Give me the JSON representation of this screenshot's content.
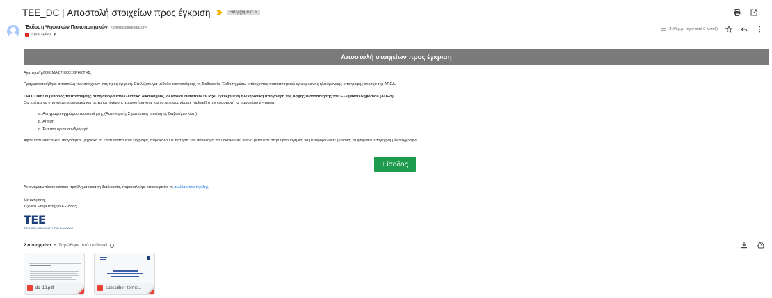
{
  "email": {
    "subject": "TEE_DC | Αποστολή στοιχείων προς έγκριση",
    "label": "Εισερχόμενα",
    "label_close": "×",
    "sender": {
      "name": "Έκδοση Ψηφιακών Πιστοποιητικών",
      "email": "<egenh@indigital.gr>",
      "to": "προς εμένα",
      "time": "8:04 μ.μ. (πριν από 0 λεπτά)"
    }
  },
  "body": {
    "banner": "Αποστολή στοιχείων προς έγκριση",
    "greeting": "Αγαπητέ/ή ΔΟΚΙΜΑΣΤΙΚΟΣ ΧΡΗΣΤΗΣ,",
    "intro": "Πραγματοποιήθηκε αποστολή των στοιχείων σας προς έγκριση. Επιλέξατε για μέθοδο ταυτοποίησης τη διαδικασία: Έκδοση μέσω υπάρχοντος πιστοποιητικού εγκεκριμένης ηλεκτρονικής υπογραφής σε ισχύ της ΑΠΕΔ.",
    "warning": "ΠΡΟΣΟΧΗ! Η μέθοδος ταυτοποίησης αυτή αφορά αποκλειστικά δικαιούχους, οι οποίοι διαθέτουν εν ισχύ εγκεκριμένη ηλεκτρονική υπογραφή της Αρχής Πιστοποίησης του Ελληνικού Δημοσίου (ΑΠΕΔ)",
    "instruction": "Θα πρέπει να υπογράψετε ψηφιακά και με χρήση έγκυρης χρονοσήμανσης και να μεταφορτώσετε (upload) στην εφαρμογή τα παρακάτω έγγραφα:",
    "documents": [
      "a. Αντίγραφο εγγράφου ταυτοποίησης (Αστυνομική, Στρατιωτική ταυτότητα, διαβατήριο κλπ.)",
      "b. Αίτηση",
      "c. Έντυπο όρων συνδρομητή"
    ],
    "followup": "Αφού κατεβάσετε και υπογράψετε ψηφιακά τα επισυναπτόμενα έγγραφα, παρακαλούμε πατήστε τον σύνδεσμο που ακολουθεί, για να μεταβείτε στην εφαρμογή και να μεταφορτώσετε (upload) τα ψηφιακά υπογεγραμμένα έγγραφα.",
    "login_button": "Είσοδος",
    "support_prefix": "Αν αντιμετωπίσετε κάποιο πρόβλημα κατά τη διαδικασία, παρακαλούμε επισκεφτείτε τη ",
    "support_link": "σελίδα υποστήριξης",
    "support_suffix": ".",
    "closing": "Με εκτίμηση,",
    "signature": "Τεχνικό Επιμελητήριο Ελλάδας",
    "logo_mark": "TEE",
    "logo_text": "ΤΕΧΝΙΚΟ ΕΠΙΜΕΛΗΤΗΡΙΟ ΕΛΛΑΔΑΣ"
  },
  "attachments": {
    "count_label": "2 συνημμένα",
    "separator": "•",
    "scan_label": "Σαρώθηκε από το Gmail",
    "files": [
      {
        "name": "dc_12.pdf"
      },
      {
        "name": "subscriber_terms..."
      }
    ]
  }
}
